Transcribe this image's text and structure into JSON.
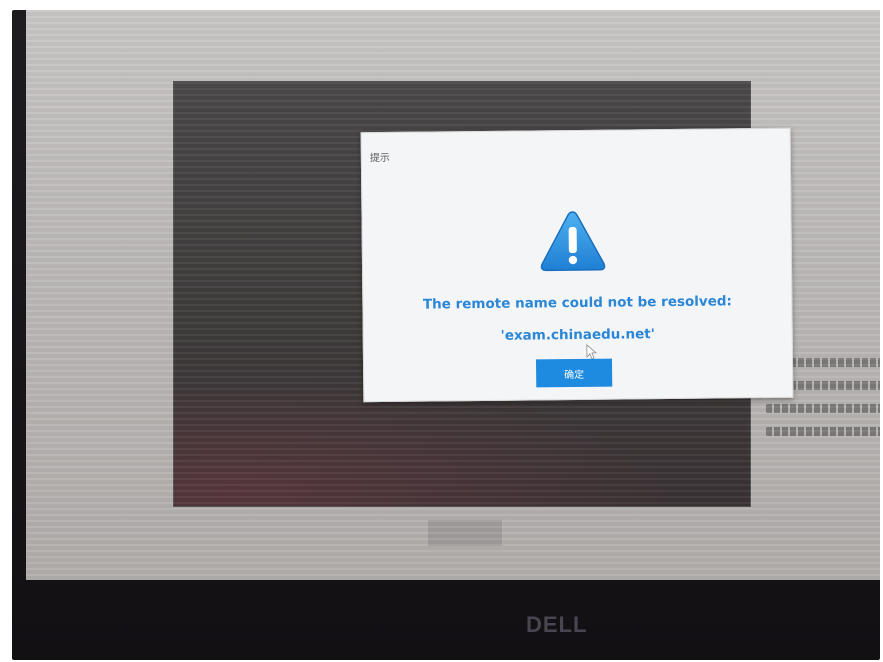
{
  "dialog": {
    "title": "提示",
    "message_line1": "The remote name could not be resolved:",
    "message_line2": "'exam.chinaedu.net'",
    "ok_label": "确定",
    "icon": "warning-triangle-icon"
  },
  "background_app": {
    "start_button_label": ""
  },
  "bezel": {
    "brand": "DELL"
  },
  "colors": {
    "accent": "#1e8ae0",
    "message_text": "#2a86d6",
    "dialog_bg": "#f4f5f7",
    "screen_bg": "#c2bfbe"
  }
}
